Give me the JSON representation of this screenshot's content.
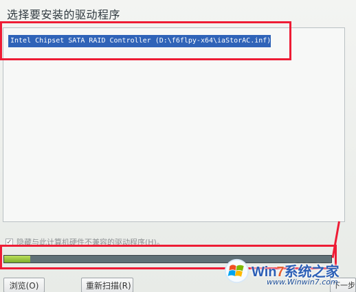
{
  "page": {
    "title": "选择要安装的驱动程序"
  },
  "driver_list": {
    "items": [
      {
        "label": "Intel Chipset SATA RAID Controller (D:\\f6flpy-x64\\iaStorAC.inf)"
      }
    ]
  },
  "options": {
    "hide_incompatible_label": "隐藏与此计算机硬件不兼容的驱动程序(H)。",
    "hide_incompatible_checked": true
  },
  "progress": {
    "value": 0.08
  },
  "buttons": {
    "browse_label": "浏览(O)",
    "rescan_label": "重新扫描(R)",
    "next_label": "下一步(N)"
  },
  "watermark": {
    "brand_win": "Win",
    "brand_7": "7",
    "brand_rest": "系统之家",
    "url": "www.Winwin7.com"
  },
  "colors": {
    "highlight": "#ee1c35",
    "selection": "#2f63b8",
    "progress_fill": "#8cc43a",
    "progress_track": "#5f7076"
  }
}
